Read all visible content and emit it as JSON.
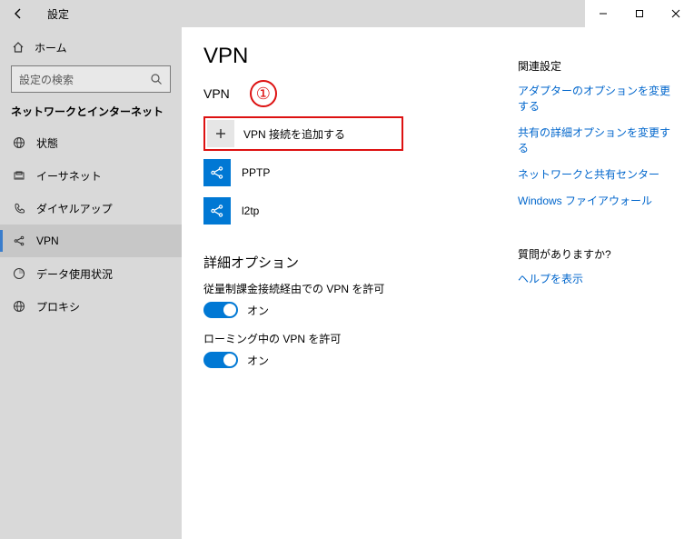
{
  "titlebar": {
    "app": "設定"
  },
  "sidebar": {
    "home": "ホーム",
    "search_placeholder": "設定の検索",
    "section": "ネットワークとインターネット",
    "items": [
      {
        "label": "状態"
      },
      {
        "label": "イーサネット"
      },
      {
        "label": "ダイヤルアップ"
      },
      {
        "label": "VPN"
      },
      {
        "label": "データ使用状況"
      },
      {
        "label": "プロキシ"
      }
    ]
  },
  "page": {
    "title": "VPN",
    "section1": "VPN",
    "annotation1": "①",
    "add_vpn": "VPN 接続を追加する",
    "connections": [
      {
        "label": "PPTP"
      },
      {
        "label": "l2tp"
      }
    ],
    "advanced_head": "詳細オプション",
    "opt1_label": "従量制課金接続経由での VPN を許可",
    "opt1_state": "オン",
    "opt2_label": "ローミング中の VPN を許可",
    "opt2_state": "オン"
  },
  "related": {
    "head1": "関連設定",
    "links1": [
      "アダプターのオプションを変更する",
      "共有の詳細オプションを変更する",
      "ネットワークと共有センター",
      "Windows ファイアウォール"
    ],
    "head2": "質問がありますか?",
    "help": "ヘルプを表示"
  }
}
